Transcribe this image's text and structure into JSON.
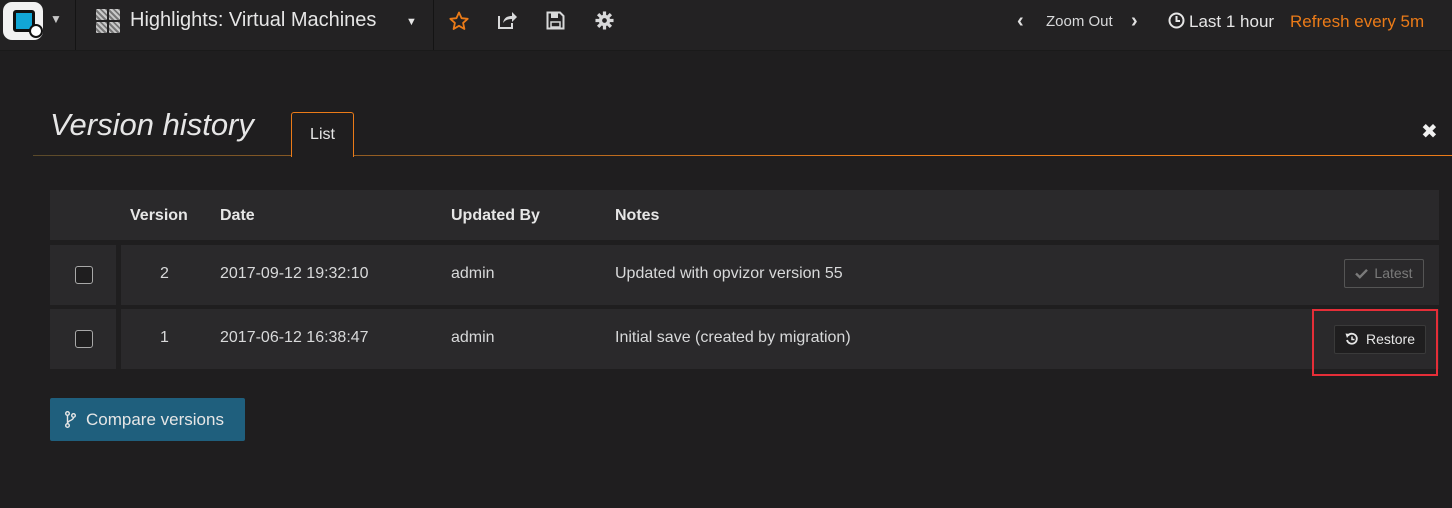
{
  "navbar": {
    "dashboard_title": "Highlights: Virtual Machines",
    "zoom_out_label": "Zoom Out",
    "time_range_label": "Last 1 hour",
    "refresh_label": "Refresh every 5m",
    "icons": [
      "star-icon",
      "share-icon",
      "save-icon",
      "gear-icon",
      "clock-icon"
    ],
    "accent_color": "#eb7b18"
  },
  "history": {
    "title": "Version history",
    "tab_label": "List",
    "columns": {
      "version": "Version",
      "date": "Date",
      "updated_by": "Updated By",
      "notes": "Notes"
    },
    "rows": [
      {
        "version": "2",
        "date": "2017-09-12 19:32:10",
        "updated_by": "admin",
        "notes": "Updated with opvizor version 55",
        "action": "Latest"
      },
      {
        "version": "1",
        "date": "2017-06-12 16:38:47",
        "updated_by": "admin",
        "notes": "Initial save (created by migration)",
        "action": "Restore"
      }
    ],
    "compare_button": "Compare versions",
    "highlight_color": "#e52e38"
  }
}
